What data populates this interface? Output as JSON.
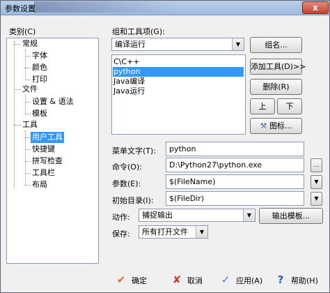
{
  "window": {
    "title": "参数设置",
    "close": "x"
  },
  "category_label": "类别(C)",
  "tree": {
    "items": [
      {
        "label": "常规"
      },
      {
        "label": "字体"
      },
      {
        "label": "颜色"
      },
      {
        "label": "打印"
      },
      {
        "label": "文件"
      },
      {
        "label": "设置 & 语法"
      },
      {
        "label": "模板"
      },
      {
        "label": "工具"
      },
      {
        "label": "用户工具"
      },
      {
        "label": "快捷键"
      },
      {
        "label": "拼写检查"
      },
      {
        "label": "工具栏"
      },
      {
        "label": "布局"
      }
    ],
    "selected": "用户工具"
  },
  "group_label": "组和工具项(G):",
  "group_combo": {
    "value": "编译运行"
  },
  "buttons": {
    "group": "组名...",
    "add_tool": "添加工具(D)>>",
    "delete": "删除(R)",
    "up": "上",
    "down": "下",
    "icon": "图标...",
    "output_template": "输出模板..."
  },
  "tool_list": {
    "items": [
      "C\\C++",
      "python",
      "Java编译",
      "Java运行"
    ],
    "selected": "python"
  },
  "form": {
    "menu_text_label": "菜单文字(T):",
    "menu_text_value": "python",
    "command_label": "命令(O):",
    "command_value": "D:\\Python27\\python.exe",
    "args_label": "参数(E):",
    "args_value": "$(FileName)",
    "init_dir_label": "初始目录(I):",
    "init_dir_value": "$(FileDir)",
    "action_label": "动作:",
    "action_value": "捕捉输出",
    "save_label": "保存:",
    "save_value": "所有打开文件",
    "browse": "..."
  },
  "bottom": {
    "ok": "确定",
    "cancel": "取消",
    "apply": "应用(A)",
    "help": "帮助(H)"
  },
  "colors": {
    "selection": "#3399ff",
    "ok_icon": "#e07020",
    "cancel_icon": "#d03a2a",
    "apply_icon": "#3a7bd0",
    "help_icon": "#2a5fb0"
  }
}
